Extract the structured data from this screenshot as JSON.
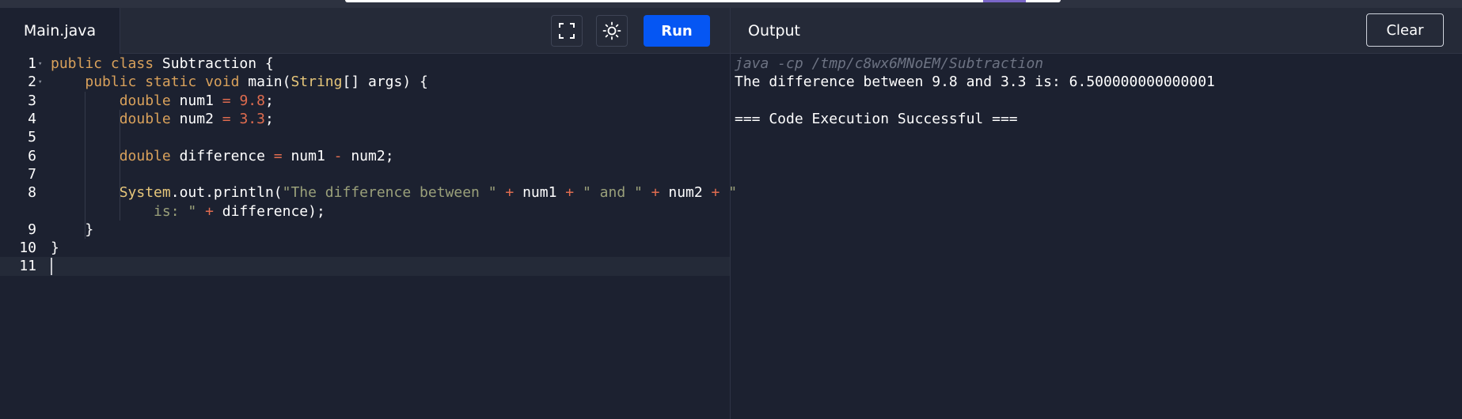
{
  "editor": {
    "file_tab": "Main.java",
    "fullscreen_icon": "fullscreen-icon",
    "theme_icon": "sun-icon",
    "run_label": "Run",
    "lines": [
      {
        "n": "1",
        "fold": true,
        "tokens": [
          [
            "kw",
            "public "
          ],
          [
            "kw",
            "class "
          ],
          [
            "plain",
            "Subtraction {"
          ]
        ]
      },
      {
        "n": "2",
        "fold": true,
        "tokens": [
          [
            "plain",
            "    "
          ],
          [
            "kw",
            "public "
          ],
          [
            "kw",
            "static "
          ],
          [
            "kw",
            "void "
          ],
          [
            "plain",
            "main("
          ],
          [
            "cls",
            "String"
          ],
          [
            "plain",
            "[] args) {"
          ]
        ]
      },
      {
        "n": "3",
        "fold": false,
        "tokens": [
          [
            "plain",
            "        "
          ],
          [
            "kw",
            "double "
          ],
          [
            "plain",
            "num1 "
          ],
          [
            "op",
            "= "
          ],
          [
            "num",
            "9.8"
          ],
          [
            "plain",
            ";"
          ]
        ]
      },
      {
        "n": "4",
        "fold": false,
        "tokens": [
          [
            "plain",
            "        "
          ],
          [
            "kw",
            "double "
          ],
          [
            "plain",
            "num2 "
          ],
          [
            "op",
            "= "
          ],
          [
            "num",
            "3.3"
          ],
          [
            "plain",
            ";"
          ]
        ]
      },
      {
        "n": "5",
        "fold": false,
        "tokens": []
      },
      {
        "n": "6",
        "fold": false,
        "tokens": [
          [
            "plain",
            "        "
          ],
          [
            "kw",
            "double "
          ],
          [
            "plain",
            "difference "
          ],
          [
            "op",
            "= "
          ],
          [
            "plain",
            "num1 "
          ],
          [
            "op",
            "- "
          ],
          [
            "plain",
            "num2;"
          ]
        ]
      },
      {
        "n": "7",
        "fold": false,
        "tokens": []
      },
      {
        "n": "8",
        "fold": false,
        "tokens": [
          [
            "plain",
            "        "
          ],
          [
            "cls",
            "System"
          ],
          [
            "plain",
            ".out.println("
          ],
          [
            "str",
            "\"The difference between \""
          ],
          [
            "plain",
            " "
          ],
          [
            "op",
            "+"
          ],
          [
            "plain",
            " num1 "
          ],
          [
            "op",
            "+"
          ],
          [
            "plain",
            " "
          ],
          [
            "str",
            "\" and \""
          ],
          [
            "plain",
            " "
          ],
          [
            "op",
            "+"
          ],
          [
            "plain",
            " num2 "
          ],
          [
            "op",
            "+"
          ],
          [
            "plain",
            " "
          ],
          [
            "str",
            "\""
          ]
        ]
      },
      {
        "n": "",
        "fold": false,
        "tokens": [
          [
            "plain",
            "            "
          ],
          [
            "str",
            "is: \""
          ],
          [
            "plain",
            " "
          ],
          [
            "op",
            "+"
          ],
          [
            "plain",
            " difference);"
          ]
        ]
      },
      {
        "n": "9",
        "fold": false,
        "tokens": [
          [
            "plain",
            "    }"
          ]
        ]
      },
      {
        "n": "10",
        "fold": false,
        "tokens": [
          [
            "plain",
            "}"
          ]
        ]
      },
      {
        "n": "11",
        "fold": false,
        "tokens": [],
        "active": true
      }
    ]
  },
  "output": {
    "title": "Output",
    "clear_label": "Clear",
    "command": "java -cp /tmp/c8wx6MNoEM/Subtraction",
    "lines": [
      "The difference between 9.8 and 3.3 is: 6.500000000000001",
      "",
      "=== Code Execution Successful ==="
    ]
  }
}
